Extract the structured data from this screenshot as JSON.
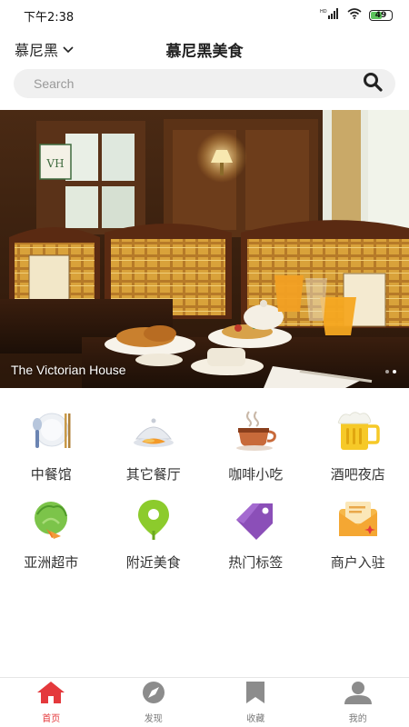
{
  "status": {
    "time": "下午2:38",
    "battery": "49",
    "network": "HD"
  },
  "header": {
    "city": "慕尼黑",
    "title": "慕尼黑美食"
  },
  "search": {
    "placeholder": "Search"
  },
  "banner": {
    "caption": "The Victorian House",
    "slide_count": 2,
    "active_slide": 2
  },
  "categories": [
    {
      "label": "中餐馆",
      "icon": "chinese-restaurant-icon"
    },
    {
      "label": "其它餐厅",
      "icon": "other-restaurant-icon"
    },
    {
      "label": "咖啡小吃",
      "icon": "coffee-icon"
    },
    {
      "label": "酒吧夜店",
      "icon": "beer-icon"
    },
    {
      "label": "亚洲超市",
      "icon": "vegetable-icon"
    },
    {
      "label": "附近美食",
      "icon": "location-pin-icon"
    },
    {
      "label": "热门标签",
      "icon": "tag-icon"
    },
    {
      "label": "商户入驻",
      "icon": "envelope-icon"
    }
  ],
  "tabbar": [
    {
      "label": "首页",
      "icon": "home-icon",
      "active": true
    },
    {
      "label": "发现",
      "icon": "compass-icon",
      "active": false
    },
    {
      "label": "收藏",
      "icon": "bookmark-icon",
      "active": false
    },
    {
      "label": "我的",
      "icon": "user-icon",
      "active": false
    }
  ],
  "colors": {
    "accent": "#e4393c",
    "tab_inactive": "#888888",
    "search_bg": "#f0f0f0"
  }
}
